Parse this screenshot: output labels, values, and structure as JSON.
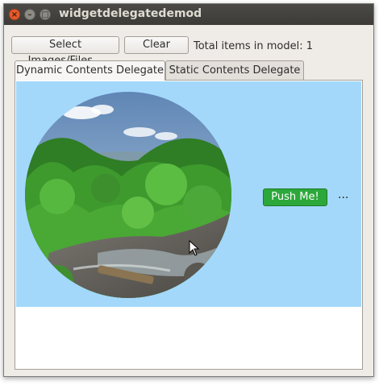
{
  "window": {
    "title": "widgetdelegatedemod"
  },
  "titlebar_icons": {
    "close": "close-icon",
    "minimize": "minimize-icon",
    "maximize": "maximize-icon"
  },
  "toolbar": {
    "select_label": "Select Images/Files...",
    "clear_label": "Clear",
    "count_label": "Total items in model: 1"
  },
  "tabs": [
    {
      "label": "Dynamic Contents Delegate",
      "active": true
    },
    {
      "label": "Static Contents Delegate",
      "active": false
    }
  ],
  "item": {
    "button_label": "Push Me!",
    "ellipsis": "...",
    "image": "landscape-photo-forest-river"
  },
  "colors": {
    "view_background": "#a3d8fb",
    "push_button": "#2ca83a",
    "title_bar": "#3c3b37"
  }
}
